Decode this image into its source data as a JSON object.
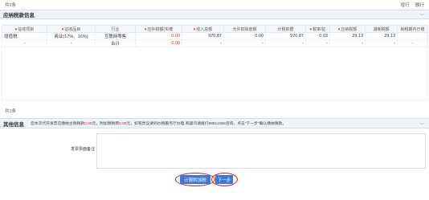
{
  "topbar": {
    "count": "共1条",
    "add_row": "增行",
    "delete_row": "删行"
  },
  "tax_section": {
    "title": "应纳税款信息"
  },
  "table": {
    "columns": [
      {
        "label": "征收项目",
        "required": true
      },
      {
        "label": "征收品目",
        "required": true
      },
      {
        "label": "行业",
        "required": false
      },
      {
        "label": "应补税额(实缴",
        "required": true
      },
      {
        "label": "收入总额",
        "required": true
      },
      {
        "label": "允许扣除金额",
        "required": false
      },
      {
        "label": "计税依据",
        "required": false
      },
      {
        "label": "税率/征",
        "required": true
      },
      {
        "label": "应纳税额",
        "required": true
      },
      {
        "label": "减免税额",
        "required": false
      },
      {
        "label": "纳税期内已缴",
        "required": false
      }
    ],
    "rows": [
      [
        "增值税",
        "商业(17%、16%)",
        "互联网零售",
        "0.00",
        "970.87",
        "0.00",
        "970.87",
        "0.03",
        "29.13",
        "29.13",
        ""
      ],
      [
        "-",
        "-",
        "合计",
        "0.00",
        "-",
        "-",
        "-",
        "-",
        "-",
        "-",
        "-"
      ]
    ]
  },
  "footer_count": "共1条",
  "other_section": {
    "title": "其他信息",
    "notice_prefix": "您本次代开发票应缴纳主税税款",
    "main_tax_amount": "0.00",
    "notice_mid": "元，附加税税费",
    "surcharge_amount": "0.00",
    "notice_suffix": "元，如有异议请到办税服务厅办理,有疑问请拨打88812366咨询，点击\"下一步\"确认缴纳税款。"
  },
  "remark": {
    "label": "发票票面备注",
    "value": ""
  },
  "buttons": {
    "calc_surcharge": "计算附加税",
    "next": "下一步"
  },
  "colors": {
    "accent": "#3b78d8",
    "highlight": "#e02020",
    "section_bg": "#eef3f8"
  }
}
